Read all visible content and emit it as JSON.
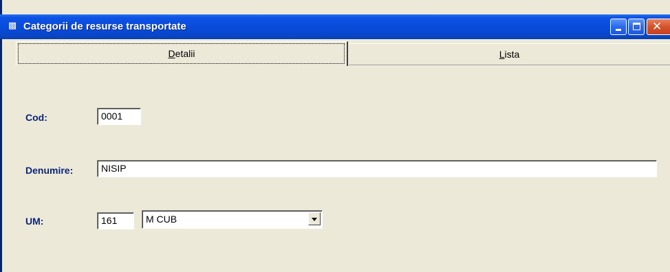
{
  "window": {
    "title": "Categorii de resurse transportate",
    "icon": "app-window-icon"
  },
  "tabs": [
    {
      "label_prefix": "",
      "label_underlined": "D",
      "label_rest": "etalii",
      "active": true
    },
    {
      "label_prefix": "",
      "label_underlined": "L",
      "label_rest": "ista",
      "active": false
    }
  ],
  "form": {
    "cod": {
      "label": "Cod:",
      "value": "0001"
    },
    "denumire": {
      "label": "Denumire:",
      "value": "NISIP"
    },
    "um": {
      "label": "UM:",
      "code_value": "161",
      "selected_option": "M CUB"
    }
  },
  "colors": {
    "titlebar": "#0a4ad8",
    "label_text": "#0a247a",
    "face": "#ece9d8",
    "close_button": "#d6512c"
  }
}
